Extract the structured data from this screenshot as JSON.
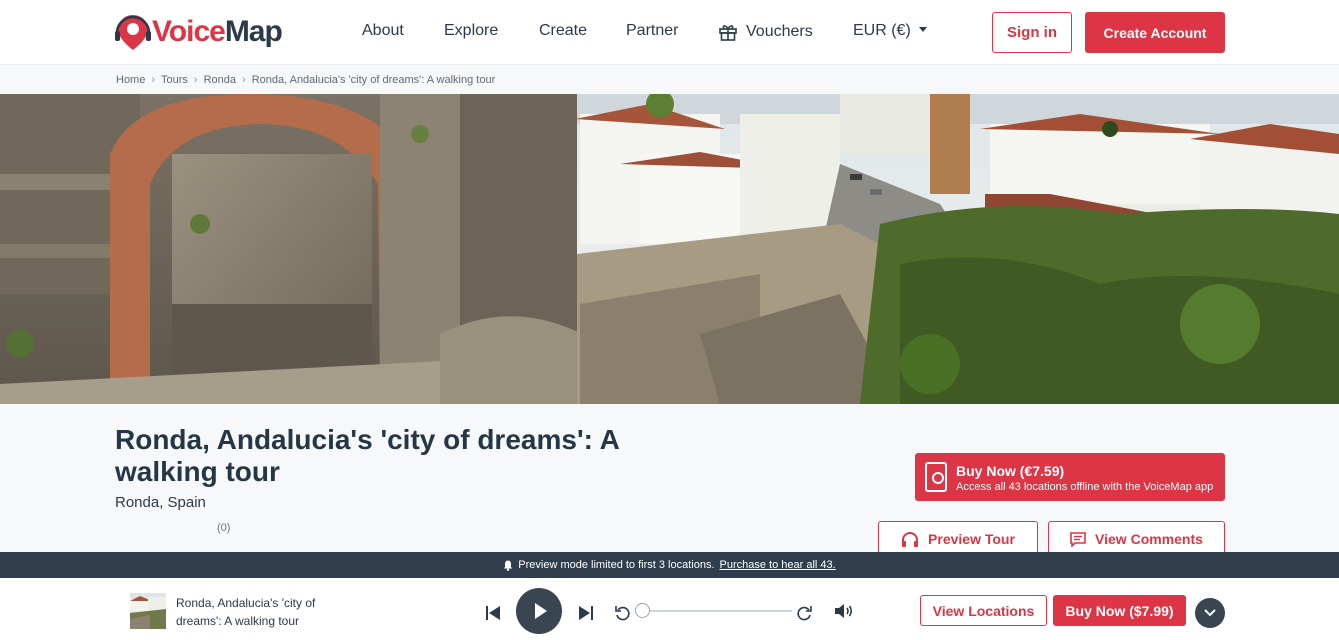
{
  "header": {
    "logo_voice": "Voice",
    "logo_map": "Map",
    "nav": {
      "about": "About",
      "explore": "Explore",
      "create": "Create",
      "partner": "Partner",
      "vouchers": "Vouchers",
      "currency": "EUR (€)"
    },
    "sign_in": "Sign in",
    "create_account": "Create Account"
  },
  "breadcrumb": {
    "home": "Home",
    "tours": "Tours",
    "city": "Ronda",
    "current": "Ronda, Andalucia's 'city of dreams': A walking tour"
  },
  "tour": {
    "title": "Ronda, Andalucia's 'city of dreams': A walking tour",
    "location": "Ronda, Spain",
    "rating_count": "(0)"
  },
  "buy_card": {
    "title": "Buy Now (€7.59)",
    "subtitle": "Access all 43 locations offline with the VoiceMap app"
  },
  "actions": {
    "preview": "Preview Tour",
    "comments": "View Comments"
  },
  "preview_bar": {
    "message": "Preview mode limited to first 3 locations.",
    "link": "Purchase to hear all 43."
  },
  "player": {
    "title": "Ronda, Andalucia's 'city of dreams': A walking tour",
    "progress": 0,
    "view_locations": "View Locations",
    "buy": "Buy Now ($7.99)"
  },
  "colors": {
    "accent": "#dc3545",
    "dark": "#2b3a4a",
    "banner": "#2f3d4c"
  }
}
